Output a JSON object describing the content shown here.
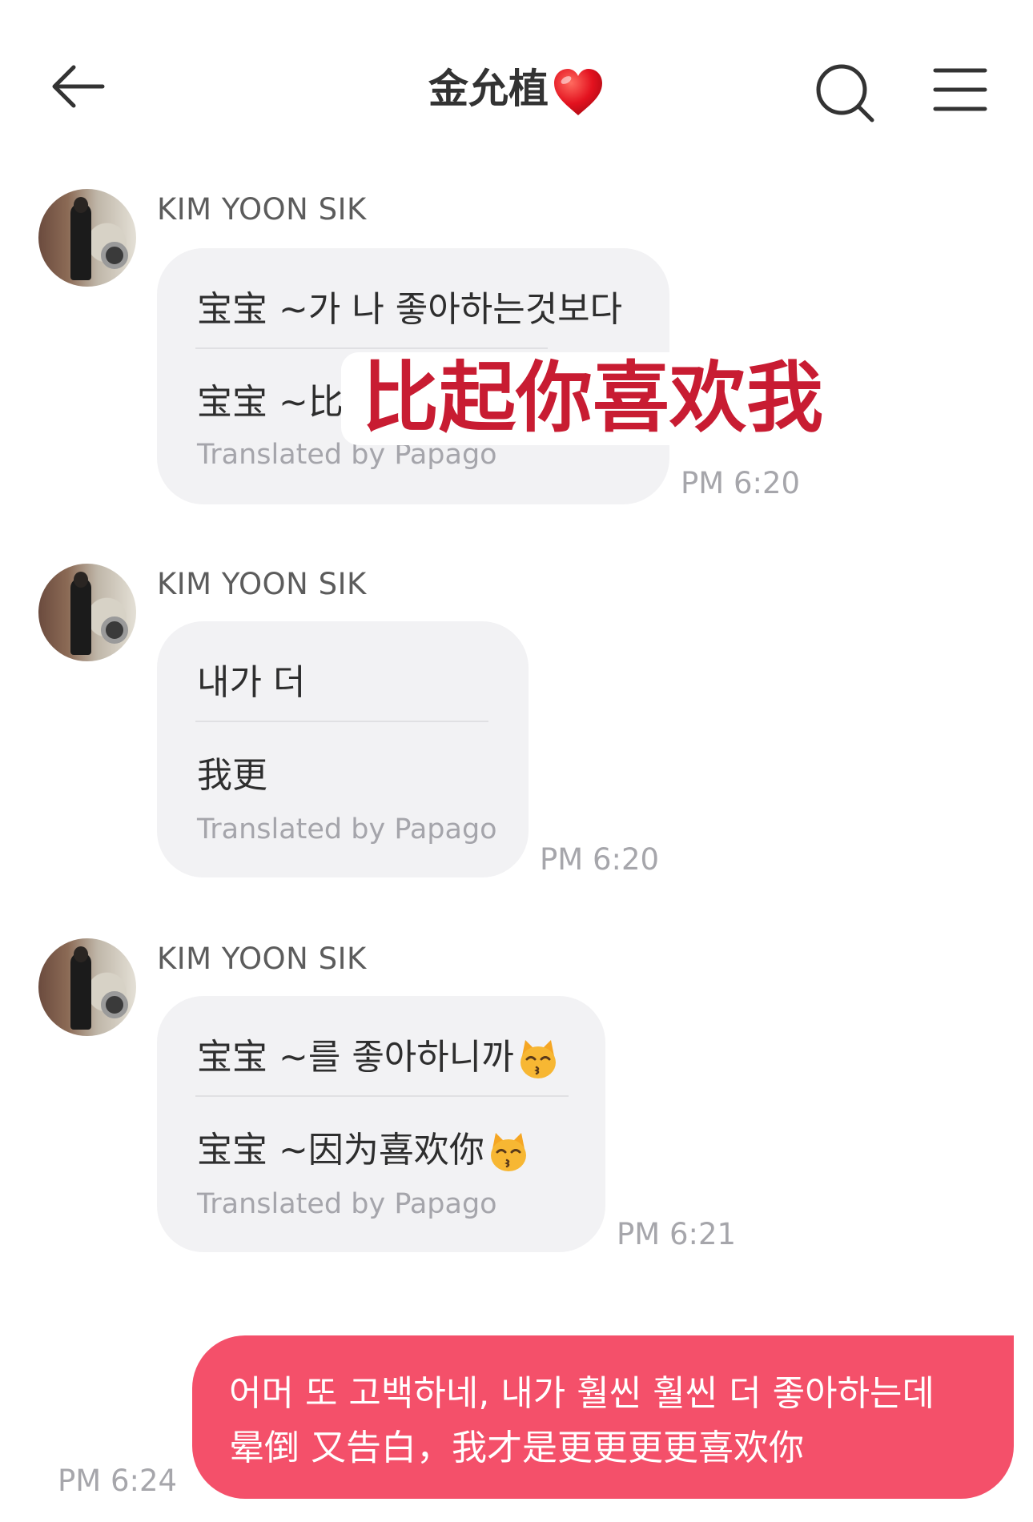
{
  "header": {
    "back_icon": "arrow-left-icon",
    "title": "金允植",
    "title_emoji": "heart-icon",
    "search_icon": "search-icon",
    "menu_icon": "hamburger-menu-icon"
  },
  "messages": [
    {
      "sender": "KIM YOON SIK",
      "original": "宝宝 ~가 나 좋아하는것보다",
      "translated": "宝宝 ~比",
      "translated_by": "Translated by Papago",
      "time": "PM 6:20"
    },
    {
      "sender": "KIM YOON SIK",
      "original": "내가 더",
      "translated": "我更",
      "translated_by": "Translated by Papago",
      "time": "PM 6:20"
    },
    {
      "sender": "KIM YOON SIK",
      "original": "宝宝 ~를 좋아하니까",
      "translated": "宝宝 ~因为喜欢你",
      "translated_by": "Translated by Papago",
      "time": "PM 6:21"
    }
  ],
  "overlay_caption": "比起你喜欢我",
  "my_message": {
    "line1": "어머 또 고백하네, 내가 훨씬 훨씬 더 좋아하는데",
    "line2": "晕倒 又告白，我才是更更更更喜欢你",
    "time": "PM 6:24"
  },
  "colors": {
    "my_bubble": "#f4506a",
    "their_bubble": "#f2f2f4",
    "overlay_text": "#c81c32"
  }
}
